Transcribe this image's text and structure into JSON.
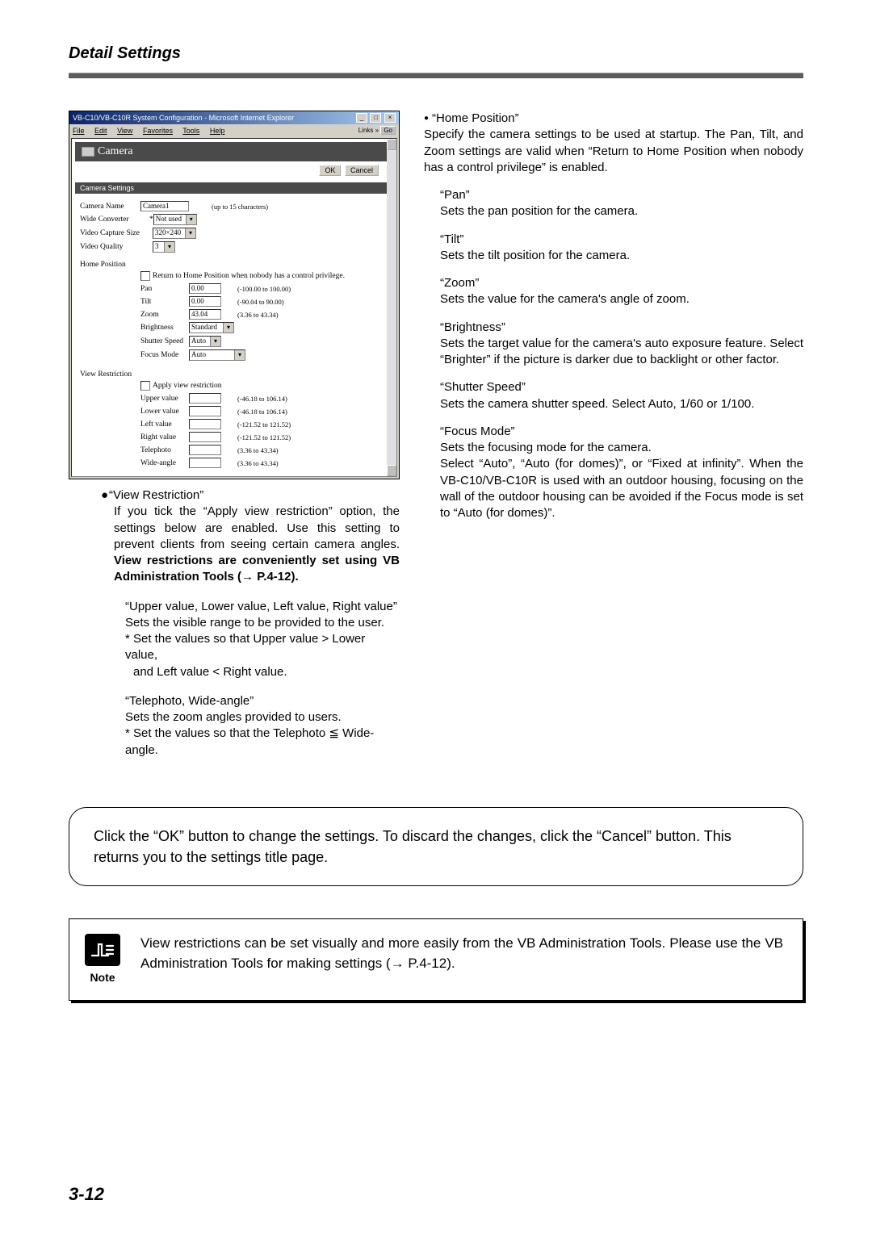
{
  "header": {
    "title": "Detail Settings"
  },
  "browser": {
    "title": "VB-C10/VB-C10R System Configuration - Microsoft Internet Explorer",
    "menus": [
      "File",
      "Edit",
      "View",
      "Favorites",
      "Tools",
      "Help"
    ],
    "links_label": "Links",
    "go_label": "Go",
    "ok_label": "OK",
    "cancel_label": "Cancel",
    "camera_band": "Camera",
    "settings_band": "Camera Settings",
    "camera_name_label": "Camera Name",
    "camera_name_value": "Camera1",
    "camera_name_hint": "(up to 15 characters)",
    "wide_converter_label": "Wide Converter",
    "wide_converter_value": "Not used",
    "video_capture_size_label": "Video Capture Size",
    "video_capture_size_value": "320×240",
    "video_quality_label": "Video Quality",
    "video_quality_value": "3",
    "home_position_label": "Home Position",
    "return_checkbox_label": "Return to Home Position when nobody has a control privilege.",
    "pan_label": "Pan",
    "pan_value": "0.00",
    "pan_hint": "(-100.00 to 100.00)",
    "tilt_label": "Tilt",
    "tilt_value": "0.00",
    "tilt_hint": "(-90.04 to 90.00)",
    "zoom_label": "Zoom",
    "zoom_value": "43.04",
    "zoom_hint": "(3.36 to 43.34)",
    "brightness_label": "Brightness",
    "brightness_value": "Standard",
    "shutter_speed_label": "Shutter Speed",
    "shutter_speed_value": "Auto",
    "focus_mode_label": "Focus Mode",
    "focus_mode_value": "Auto",
    "view_restriction_label": "View Restriction",
    "apply_view_label": "Apply view restriction",
    "upper_label": "Upper value",
    "upper_hint": "(-46.18 to 106.14)",
    "lower_label": "Lower value",
    "lower_hint": "(-46.18 to 106.14)",
    "left_label": "Left value",
    "left_hint": "(-121.52 to 121.52)",
    "right_label": "Right value",
    "right_hint": "(-121.52 to 121.52)",
    "telephoto_label": "Telephoto",
    "telephoto_hint": "(3.36 to 43.34)",
    "wideangle_label": "Wide-angle",
    "wideangle_hint": "(3.36 to 43.34)"
  },
  "left_text": {
    "vr_head": "“View Restriction”",
    "vr_body_1": "If you tick the “Apply view restriction” option, the settings below are enabled. Use this setting to prevent clients from seeing certain camera angles. ",
    "vr_body_bold": "View restrictions are conveniently set using VB Administration Tools (→ P.4-12).",
    "ulrl_head": "“Upper value, Lower value, Left value, Right value”",
    "ulrl_line1": "Sets the visible range to be provided to the user.",
    "ulrl_line2": "* Set the values so that Upper value > Lower value,",
    "ulrl_line3": "  and Left value < Right value.",
    "tw_head": "“Telephoto, Wide-angle”",
    "tw_line1": "Sets the zoom angles provided to users.",
    "tw_line2": "* Set the values so that the Telephoto ≦ Wide-angle."
  },
  "right_text": {
    "hp_head": "“Home Position”",
    "hp_body": "Specify the camera settings to be used at startup. The Pan, Tilt, and Zoom settings are valid when “Return to Home Position when nobody has a control privilege” is enabled.",
    "pan_head": "“Pan”",
    "pan_body": "Sets the pan position for the camera.",
    "tilt_head": "“Tilt”",
    "tilt_body": "Sets the tilt position for the camera.",
    "zoom_head": "“Zoom”",
    "zoom_body": "Sets the value for the camera's angle of zoom.",
    "bright_head": "“Brightness”",
    "bright_body": "Sets the target value for the camera's auto exposure feature. Select “Brighter” if the picture is darker due to backlight or other factor.",
    "shutter_head": "“Shutter Speed”",
    "shutter_body": "Sets the camera shutter speed. Select Auto, 1/60 or 1/100.",
    "focus_head": "“Focus Mode”",
    "focus_body": "Sets the focusing mode for the camera.\nSelect “Auto”, “Auto (for domes)”, or “Fixed at infinity”. When the VB-C10/VB-C10R is used with an outdoor housing, focusing on the wall of the outdoor housing can be avoided if the Focus mode is set to “Auto (for domes)”."
  },
  "rounded": "Click the “OK” button to change the settings. To discard the changes, click the “Cancel” button. This returns you to the settings title page.",
  "note": {
    "label": "Note",
    "text": "View restrictions can be set visually and more easily from the VB Administration Tools. Please use the VB Administration Tools for making settings (→ P.4-12)."
  },
  "page_number": "3-12"
}
